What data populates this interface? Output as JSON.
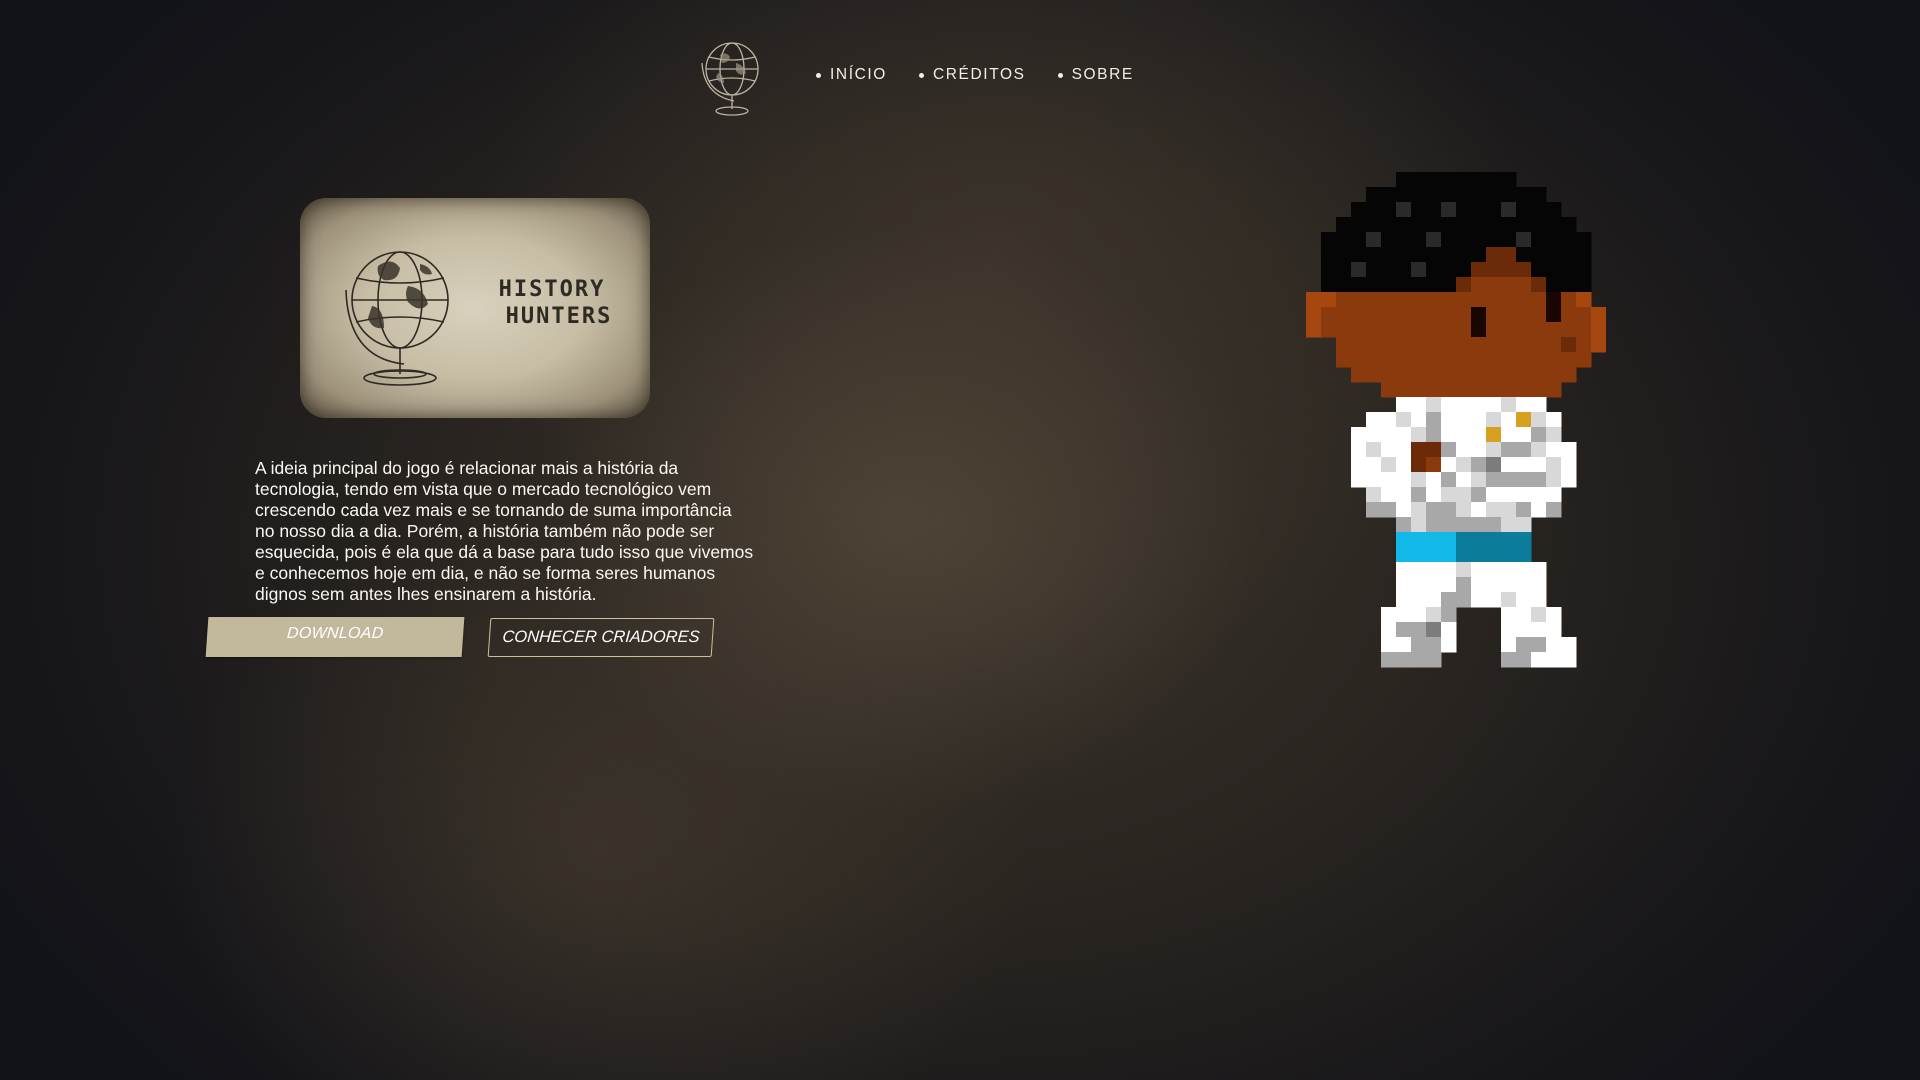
{
  "nav": {
    "logo_icon": "globe-icon",
    "items": [
      {
        "label": "INÍCIO"
      },
      {
        "label": "CRÉDITOS"
      },
      {
        "label": "SOBRE"
      }
    ]
  },
  "hero": {
    "card_title_line1": "HISTORY",
    "card_title_line2": "HUNTERS",
    "card_icon": "globe-icon",
    "description": "A ideia principal do jogo é relacionar mais a história da tecnologia, tendo em vista que o mercado tecnológico vem crescendo cada vez mais e se tornando de suma importância no nosso dia a dia. Porém, a história também não pode ser esquecida, pois é ela que dá a base para tudo isso que vivemos e conhecemos hoje em dia, e não se forma seres humanos dignos sem antes lhes ensinarem a história.",
    "download_label": "DOWNLOAD",
    "creators_label": "CONHECER CRIADORES"
  },
  "character": {
    "icon": "pixel-character-icon"
  },
  "colors": {
    "button_fill": "#c2b99d",
    "button_border": "#cdbf9b",
    "card_paper": "#c7bda5"
  }
}
